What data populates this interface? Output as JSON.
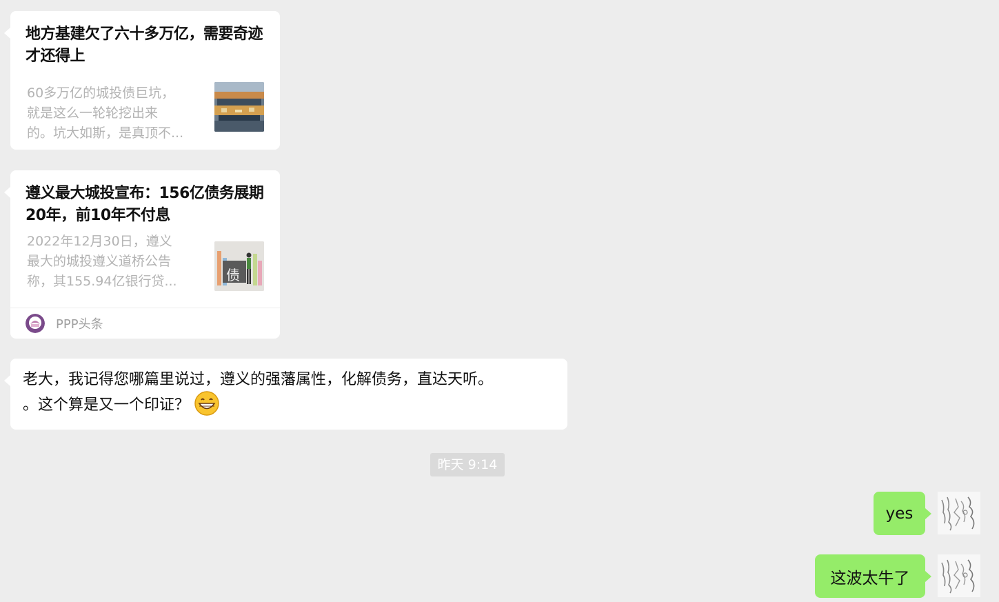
{
  "messages": {
    "card1": {
      "title": "地方基建欠了六十多万亿，需要奇迹才还得上",
      "desc_lines": [
        "60多万亿的城投债巨坑，",
        "就是这么一轮轮挖出来",
        "的。坑大如斯，是真顶不..."
      ]
    },
    "card2": {
      "title": "遵义最大城投宣布：156亿债务展期20年，前10年不付息",
      "desc_lines": [
        "2022年12月30日，遵义",
        "最大的城投遵义道桥公告",
        "称，其155.94亿银行贷..."
      ],
      "thumb_char": "债",
      "source": "PPP头条"
    },
    "text_left": {
      "line1": "老大，我记得您哪篇里说过，遵义的强藩属性，化解债务，直达天听。",
      "line2": "。这个算是又一个印证？",
      "emoji": "grinning-face-emoji"
    },
    "timestamp": "昨天 9:14",
    "right1": "yes",
    "right2": "这波太牛了"
  },
  "colors": {
    "background": "#ededed",
    "bubble_self": "#95ec69",
    "bubble_other": "#ffffff"
  }
}
